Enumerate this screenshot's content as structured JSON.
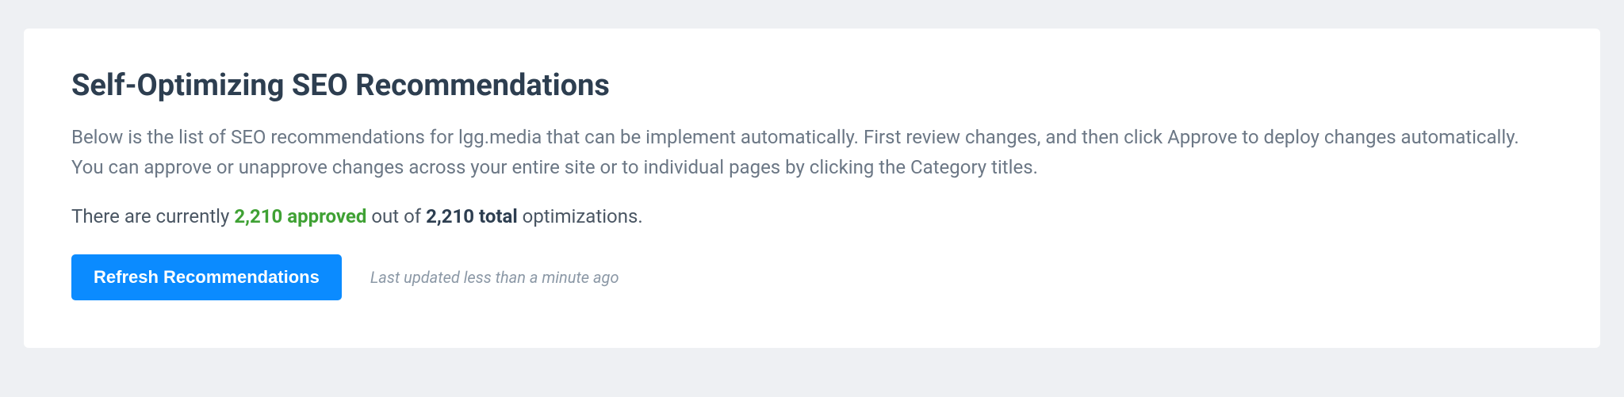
{
  "header": {
    "title": "Self-Optimizing SEO Recommendations"
  },
  "description": "Below is the list of SEO recommendations for lgg.media that can be implement automatically. First review changes, and then click Approve to deploy changes automatically. You can approve or unapprove changes across your entire site or to individual pages by clicking the Category titles.",
  "summary": {
    "prefix": "There are currently ",
    "approved_count": "2,210 approved",
    "middle": " out of ",
    "total_count": "2,210 total",
    "suffix": " optimizations."
  },
  "actions": {
    "refresh_label": "Refresh Recommendations",
    "last_updated": "Last updated less than a minute ago"
  }
}
